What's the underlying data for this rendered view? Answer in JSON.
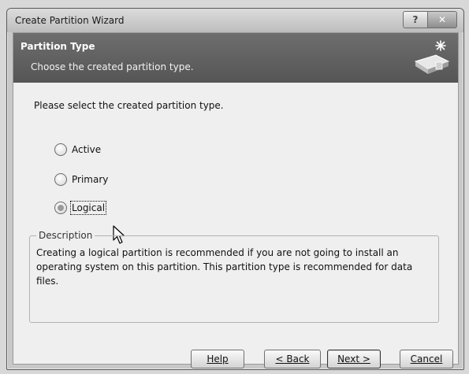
{
  "window": {
    "title": "Create Partition Wizard",
    "help_glyph": "?",
    "close_glyph": "✕"
  },
  "banner": {
    "title": "Partition Type",
    "subtitle": "Choose the created partition type."
  },
  "prompt": "Please select the created partition type.",
  "options": [
    {
      "label": "Active",
      "selected": false
    },
    {
      "label": "Primary",
      "selected": false
    },
    {
      "label": "Logical",
      "selected": true
    }
  ],
  "description": {
    "legend": "Description",
    "text": "Creating a logical partition is recommended if you are not going to install an operating system on this partition. This partition type is recommended for data files."
  },
  "buttons": {
    "help": "Help",
    "back": "< Back",
    "next": "Next >",
    "cancel": "Cancel"
  },
  "icons": {
    "help": "help-icon",
    "close": "close-icon",
    "wizard": "wizard-disk-icon",
    "cursor": "mouse-pointer-icon"
  }
}
